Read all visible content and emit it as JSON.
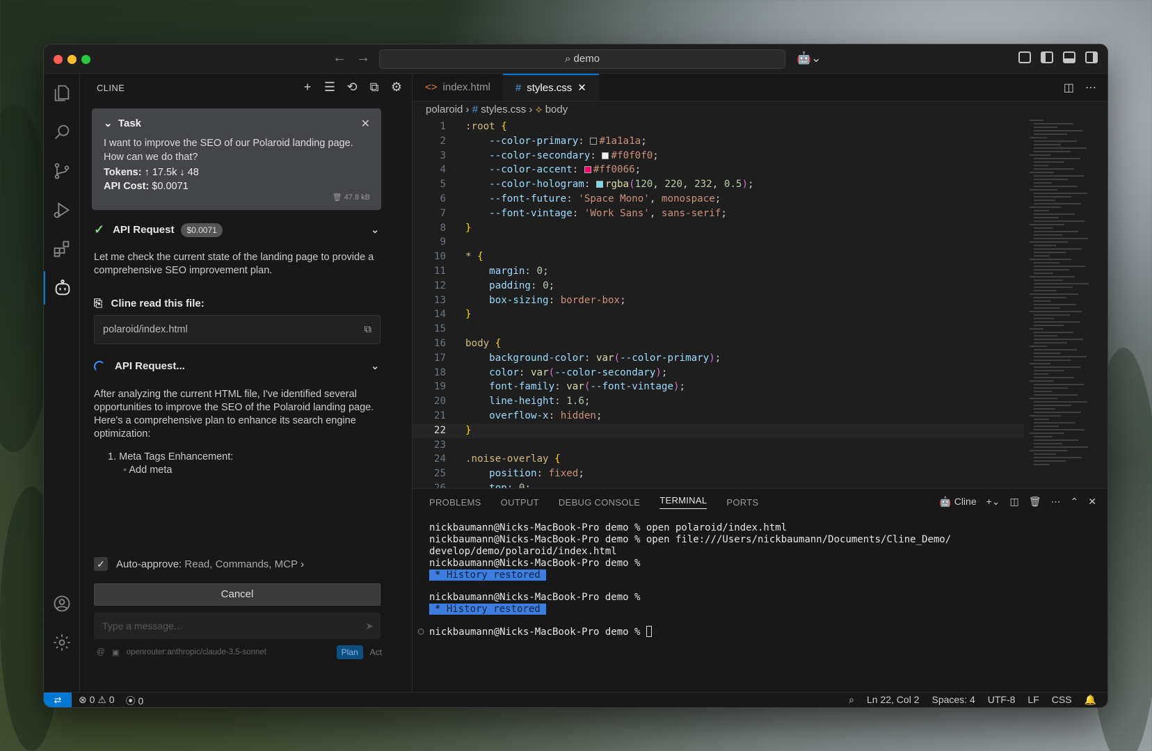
{
  "window": {
    "search": "demo"
  },
  "cline": {
    "title": "CLINE",
    "task": {
      "header": "Task",
      "text": "I want to improve the SEO of our Polaroid landing page. How can we do that?",
      "tokens_label": "Tokens:",
      "tokens_up": "17.5k",
      "tokens_down": "48",
      "cost_label": "API Cost:",
      "cost_value": "$0.0071",
      "size": "47.8 kB"
    },
    "api_request_1": {
      "label": "API Request",
      "cost": "$0.0071"
    },
    "msg1": "Let me check the current state of the landing page to provide a comprehensive SEO improvement plan.",
    "read_file_label": "Cline read this file:",
    "read_file_path": "polaroid/index.html",
    "api_request_2": {
      "label": "API Request..."
    },
    "msg2": "After analyzing the current HTML file, I've identified several opportunities to improve the SEO of the Polaroid landing page. Here's a comprehensive plan to enhance its search engine optimization:",
    "list_item_1": "1. Meta Tags Enhancement:",
    "list_subitem_1": "Add meta",
    "auto_approve_label": "Auto-approve:",
    "auto_approve_value": "Read, Commands, MCP",
    "cancel": "Cancel",
    "input_placeholder": "Type a message...",
    "model": "openrouter:anthropic/claude-3.5-sonnet",
    "mode_plan": "Plan",
    "mode_act": "Act"
  },
  "editor": {
    "tabs": [
      {
        "label": "index.html",
        "icon": "html-file-icon"
      },
      {
        "label": "styles.css",
        "icon": "css-file-icon"
      }
    ],
    "breadcrumb": {
      "folder": "polaroid",
      "file": "styles.css",
      "symbol": "body"
    },
    "code_lines": [
      "1",
      "2",
      "3",
      "4",
      "5",
      "6",
      "7",
      "8",
      "9",
      "10",
      "11",
      "12",
      "13",
      "14",
      "15",
      "16",
      "17",
      "18",
      "19",
      "20",
      "21",
      "22",
      "23",
      "24",
      "25",
      "26"
    ],
    "current_line": "22"
  },
  "colors": {
    "accent": "#0078d4",
    "primary_swatch": "#1a1a1a",
    "secondary_swatch": "#f0f0f0",
    "accent_swatch": "#ff0066",
    "hologram_swatch": "#78dce8"
  },
  "panel": {
    "tabs": [
      "PROBLEMS",
      "OUTPUT",
      "DEBUG CONSOLE",
      "TERMINAL",
      "PORTS"
    ],
    "terminal_name": "Cline",
    "lines": [
      "nickbaumann@Nicks-MacBook-Pro demo % open polaroid/index.html",
      "nickbaumann@Nicks-MacBook-Pro demo % open file:///Users/nickbaumann/Documents/Cline_Demo/",
      "develop/demo/polaroid/index.html",
      "nickbaumann@Nicks-MacBook-Pro demo %",
      "History restored",
      "nickbaumann@Nicks-MacBook-Pro demo %",
      "History restored",
      "nickbaumann@Nicks-MacBook-Pro demo %"
    ]
  },
  "status": {
    "errors": "0",
    "warnings": "0",
    "ports": "0",
    "position": "Ln 22, Col 2",
    "spaces": "Spaces: 4",
    "encoding": "UTF-8",
    "eol": "LF",
    "language": "CSS"
  }
}
